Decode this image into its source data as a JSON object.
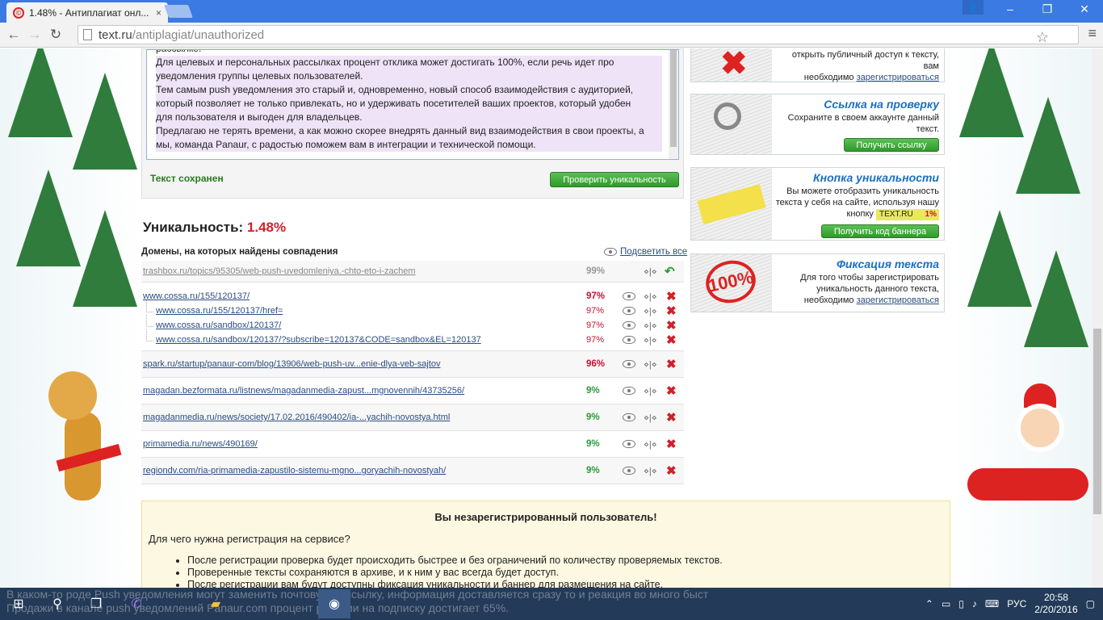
{
  "browser": {
    "tab_title": "1.48% - Антиплагиат онл...",
    "tab_close": "×",
    "url_host": "text.ru",
    "url_path": "/antiplagiat/unauthorized",
    "win_min": "–",
    "win_max": "❐",
    "win_close": "✕"
  },
  "editor": {
    "lines": [
      "рассылке.",
      "Для целевых и персональных рассылках процент отклика может достигать 100%, если речь идет про",
      "уведомления группы целевых пользователей.",
      "Тем самым push уведомления это старый и, одновременно, новый способ взаимодействия с аудиторией,",
      "который позволяет не только привлекать, но и удерживать посетителей ваших проектов, который удобен",
      "для пользователя и выгоден для владельцев.",
      "Предлагаю не терять времени, а как можно скорее внедрять данный вид взаимодействия в свои проекты, а",
      "мы, команда Panaur, с радостью поможем вам в интеграции и технической помощи."
    ],
    "saved_label": "Текст сохранен",
    "check_button": "Проверить уникальность"
  },
  "uniqueness": {
    "label": "Уникальность:",
    "value": "1.48%"
  },
  "domains": {
    "title": "Домены, на которых найдены совпадения",
    "highlight_all": "Подсветить все",
    "groups": [
      {
        "rows": [
          {
            "url": "trashbox.ru/topics/95305/web-push-uvedomleniya.-chto-eto-i-zachem",
            "pct": "99%"
          }
        ]
      },
      {
        "rows": [
          {
            "url": "www.cossa.ru/155/120137/",
            "pct": "97%"
          },
          {
            "url": "www.cossa.ru/155/120137/href=",
            "pct": "97%"
          },
          {
            "url": "www.cossa.ru/sandbox/120137/",
            "pct": "97%"
          },
          {
            "url": "www.cossa.ru/sandbox/120137/?subscribe=120137&CODE=sandbox&EL=120137",
            "pct": "97%"
          }
        ]
      },
      {
        "rows": [
          {
            "url": "spark.ru/startup/panaur-com/blog/13906/web-push-uv...enie-dlya-veb-sajtov",
            "pct": "96%"
          }
        ]
      },
      {
        "rows": [
          {
            "url": "magadan.bezformata.ru/listnews/magadanmedia-zapust...mgnovennih/43735256/",
            "pct": "9%"
          }
        ]
      },
      {
        "rows": [
          {
            "url": "magadanmedia.ru/news/society/17.02.2016/490402/ia-...yachih-novostya.html",
            "pct": "9%"
          }
        ]
      },
      {
        "rows": [
          {
            "url": "primamedia.ru/news/490169/",
            "pct": "9%"
          }
        ]
      },
      {
        "rows": [
          {
            "url": "regiondv.com/ria-primamedia-zapustilo-sistemu-mgno...goryachih-novostyah/",
            "pct": "9%"
          }
        ]
      }
    ]
  },
  "sidebar": {
    "card1": {
      "line1": "открыть публичный доступ к тексту, вам",
      "line2": "необходимо",
      "link": "зарегистрироваться"
    },
    "card2": {
      "title": "Ссылка на проверку",
      "line1": "Сохраните в своем аккаунте данный",
      "line2": "текст.",
      "button": "Получить ссылку"
    },
    "card3": {
      "title": "Кнопка уникальности",
      "line1": "Вы можете отобразить уникальность",
      "line2": "текста у себя на сайте, используя нашу",
      "line3": "кнопку",
      "badge_text": "TEXT.RU",
      "badge_pct": "1%",
      "button": "Получить код баннера"
    },
    "card4": {
      "title": "Фиксация текста",
      "line1": "Для того чтобы зарегистрировать",
      "line2": "уникальность данного текста,",
      "line3": "необходимо",
      "link": "зарегистрироваться"
    }
  },
  "notice": {
    "heading": "Вы незарегистрированный пользователь!",
    "question": "Для чего нужна регистрация на сервисе?",
    "items": [
      "После регистрации проверка будет происходить быстрее и без ограничений по количеству проверяемых текстов.",
      "Проверенные тексты сохраняются в архиве, и к ним у вас всегда будет доступ.",
      "После регистрации вам будут доступны фиксация уникальности и баннер для размещения на сайте."
    ]
  },
  "taskbar": {
    "ghost_line1": "В каком-то роде Push уведомления могут заменить почтовую рассылку, информация доставляется сразу то и реакция во много быст",
    "ghost_line2": "Продажи в канале push уведомлений Panaur.com процент реакции на подписку достигает 65%.",
    "lang": "РУС",
    "time": "20:58",
    "date": "2/20/2016"
  }
}
